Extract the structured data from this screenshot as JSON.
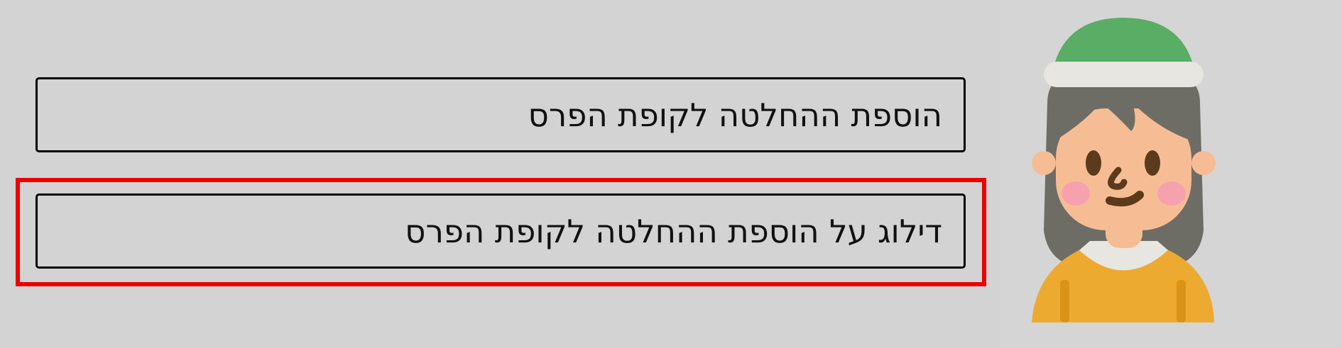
{
  "options": [
    {
      "label": "הוספת ההחלטה לקופת הפרס"
    },
    {
      "label": "דילוג על הוספת ההחלטה לקופת הפרס"
    }
  ],
  "highlight": {
    "color": "#ee0000"
  },
  "avatar": {
    "icon": "girl-avatar-icon",
    "hat_color": "#5aad65",
    "shirt_color": "#edaa30",
    "hair_color": "#6d6d66",
    "skin_color": "#f6bd95"
  }
}
